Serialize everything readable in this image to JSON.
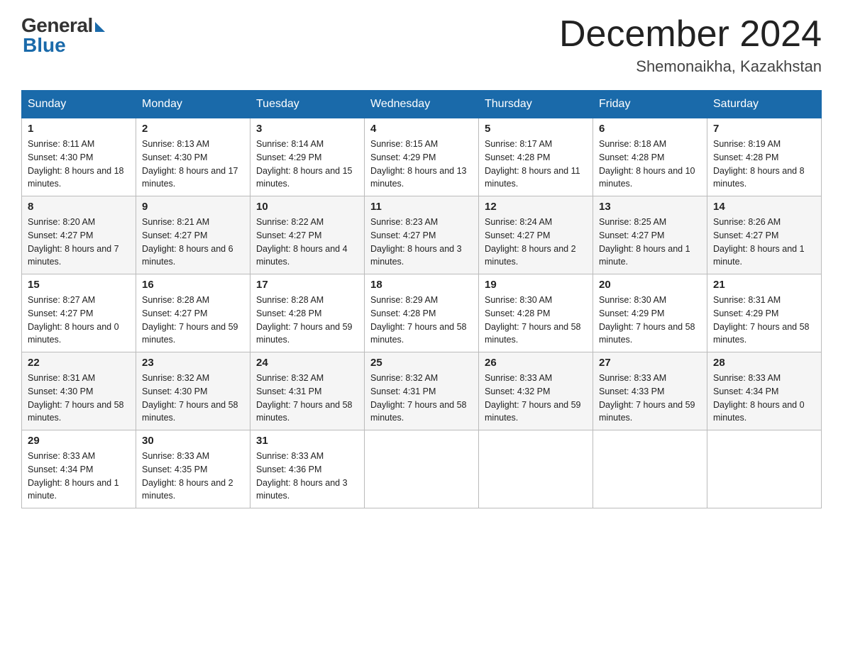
{
  "header": {
    "logo_general": "General",
    "logo_blue": "Blue",
    "month_title": "December 2024",
    "location": "Shemonaikha, Kazakhstan"
  },
  "weekdays": [
    "Sunday",
    "Monday",
    "Tuesday",
    "Wednesday",
    "Thursday",
    "Friday",
    "Saturday"
  ],
  "weeks": [
    [
      {
        "day": "1",
        "sunrise": "8:11 AM",
        "sunset": "4:30 PM",
        "daylight": "8 hours and 18 minutes."
      },
      {
        "day": "2",
        "sunrise": "8:13 AM",
        "sunset": "4:30 PM",
        "daylight": "8 hours and 17 minutes."
      },
      {
        "day": "3",
        "sunrise": "8:14 AM",
        "sunset": "4:29 PM",
        "daylight": "8 hours and 15 minutes."
      },
      {
        "day": "4",
        "sunrise": "8:15 AM",
        "sunset": "4:29 PM",
        "daylight": "8 hours and 13 minutes."
      },
      {
        "day": "5",
        "sunrise": "8:17 AM",
        "sunset": "4:28 PM",
        "daylight": "8 hours and 11 minutes."
      },
      {
        "day": "6",
        "sunrise": "8:18 AM",
        "sunset": "4:28 PM",
        "daylight": "8 hours and 10 minutes."
      },
      {
        "day": "7",
        "sunrise": "8:19 AM",
        "sunset": "4:28 PM",
        "daylight": "8 hours and 8 minutes."
      }
    ],
    [
      {
        "day": "8",
        "sunrise": "8:20 AM",
        "sunset": "4:27 PM",
        "daylight": "8 hours and 7 minutes."
      },
      {
        "day": "9",
        "sunrise": "8:21 AM",
        "sunset": "4:27 PM",
        "daylight": "8 hours and 6 minutes."
      },
      {
        "day": "10",
        "sunrise": "8:22 AM",
        "sunset": "4:27 PM",
        "daylight": "8 hours and 4 minutes."
      },
      {
        "day": "11",
        "sunrise": "8:23 AM",
        "sunset": "4:27 PM",
        "daylight": "8 hours and 3 minutes."
      },
      {
        "day": "12",
        "sunrise": "8:24 AM",
        "sunset": "4:27 PM",
        "daylight": "8 hours and 2 minutes."
      },
      {
        "day": "13",
        "sunrise": "8:25 AM",
        "sunset": "4:27 PM",
        "daylight": "8 hours and 1 minute."
      },
      {
        "day": "14",
        "sunrise": "8:26 AM",
        "sunset": "4:27 PM",
        "daylight": "8 hours and 1 minute."
      }
    ],
    [
      {
        "day": "15",
        "sunrise": "8:27 AM",
        "sunset": "4:27 PM",
        "daylight": "8 hours and 0 minutes."
      },
      {
        "day": "16",
        "sunrise": "8:28 AM",
        "sunset": "4:27 PM",
        "daylight": "7 hours and 59 minutes."
      },
      {
        "day": "17",
        "sunrise": "8:28 AM",
        "sunset": "4:28 PM",
        "daylight": "7 hours and 59 minutes."
      },
      {
        "day": "18",
        "sunrise": "8:29 AM",
        "sunset": "4:28 PM",
        "daylight": "7 hours and 58 minutes."
      },
      {
        "day": "19",
        "sunrise": "8:30 AM",
        "sunset": "4:28 PM",
        "daylight": "7 hours and 58 minutes."
      },
      {
        "day": "20",
        "sunrise": "8:30 AM",
        "sunset": "4:29 PM",
        "daylight": "7 hours and 58 minutes."
      },
      {
        "day": "21",
        "sunrise": "8:31 AM",
        "sunset": "4:29 PM",
        "daylight": "7 hours and 58 minutes."
      }
    ],
    [
      {
        "day": "22",
        "sunrise": "8:31 AM",
        "sunset": "4:30 PM",
        "daylight": "7 hours and 58 minutes."
      },
      {
        "day": "23",
        "sunrise": "8:32 AM",
        "sunset": "4:30 PM",
        "daylight": "7 hours and 58 minutes."
      },
      {
        "day": "24",
        "sunrise": "8:32 AM",
        "sunset": "4:31 PM",
        "daylight": "7 hours and 58 minutes."
      },
      {
        "day": "25",
        "sunrise": "8:32 AM",
        "sunset": "4:31 PM",
        "daylight": "7 hours and 58 minutes."
      },
      {
        "day": "26",
        "sunrise": "8:33 AM",
        "sunset": "4:32 PM",
        "daylight": "7 hours and 59 minutes."
      },
      {
        "day": "27",
        "sunrise": "8:33 AM",
        "sunset": "4:33 PM",
        "daylight": "7 hours and 59 minutes."
      },
      {
        "day": "28",
        "sunrise": "8:33 AM",
        "sunset": "4:34 PM",
        "daylight": "8 hours and 0 minutes."
      }
    ],
    [
      {
        "day": "29",
        "sunrise": "8:33 AM",
        "sunset": "4:34 PM",
        "daylight": "8 hours and 1 minute."
      },
      {
        "day": "30",
        "sunrise": "8:33 AM",
        "sunset": "4:35 PM",
        "daylight": "8 hours and 2 minutes."
      },
      {
        "day": "31",
        "sunrise": "8:33 AM",
        "sunset": "4:36 PM",
        "daylight": "8 hours and 3 minutes."
      },
      null,
      null,
      null,
      null
    ]
  ],
  "labels": {
    "sunrise": "Sunrise:",
    "sunset": "Sunset:",
    "daylight": "Daylight:"
  }
}
